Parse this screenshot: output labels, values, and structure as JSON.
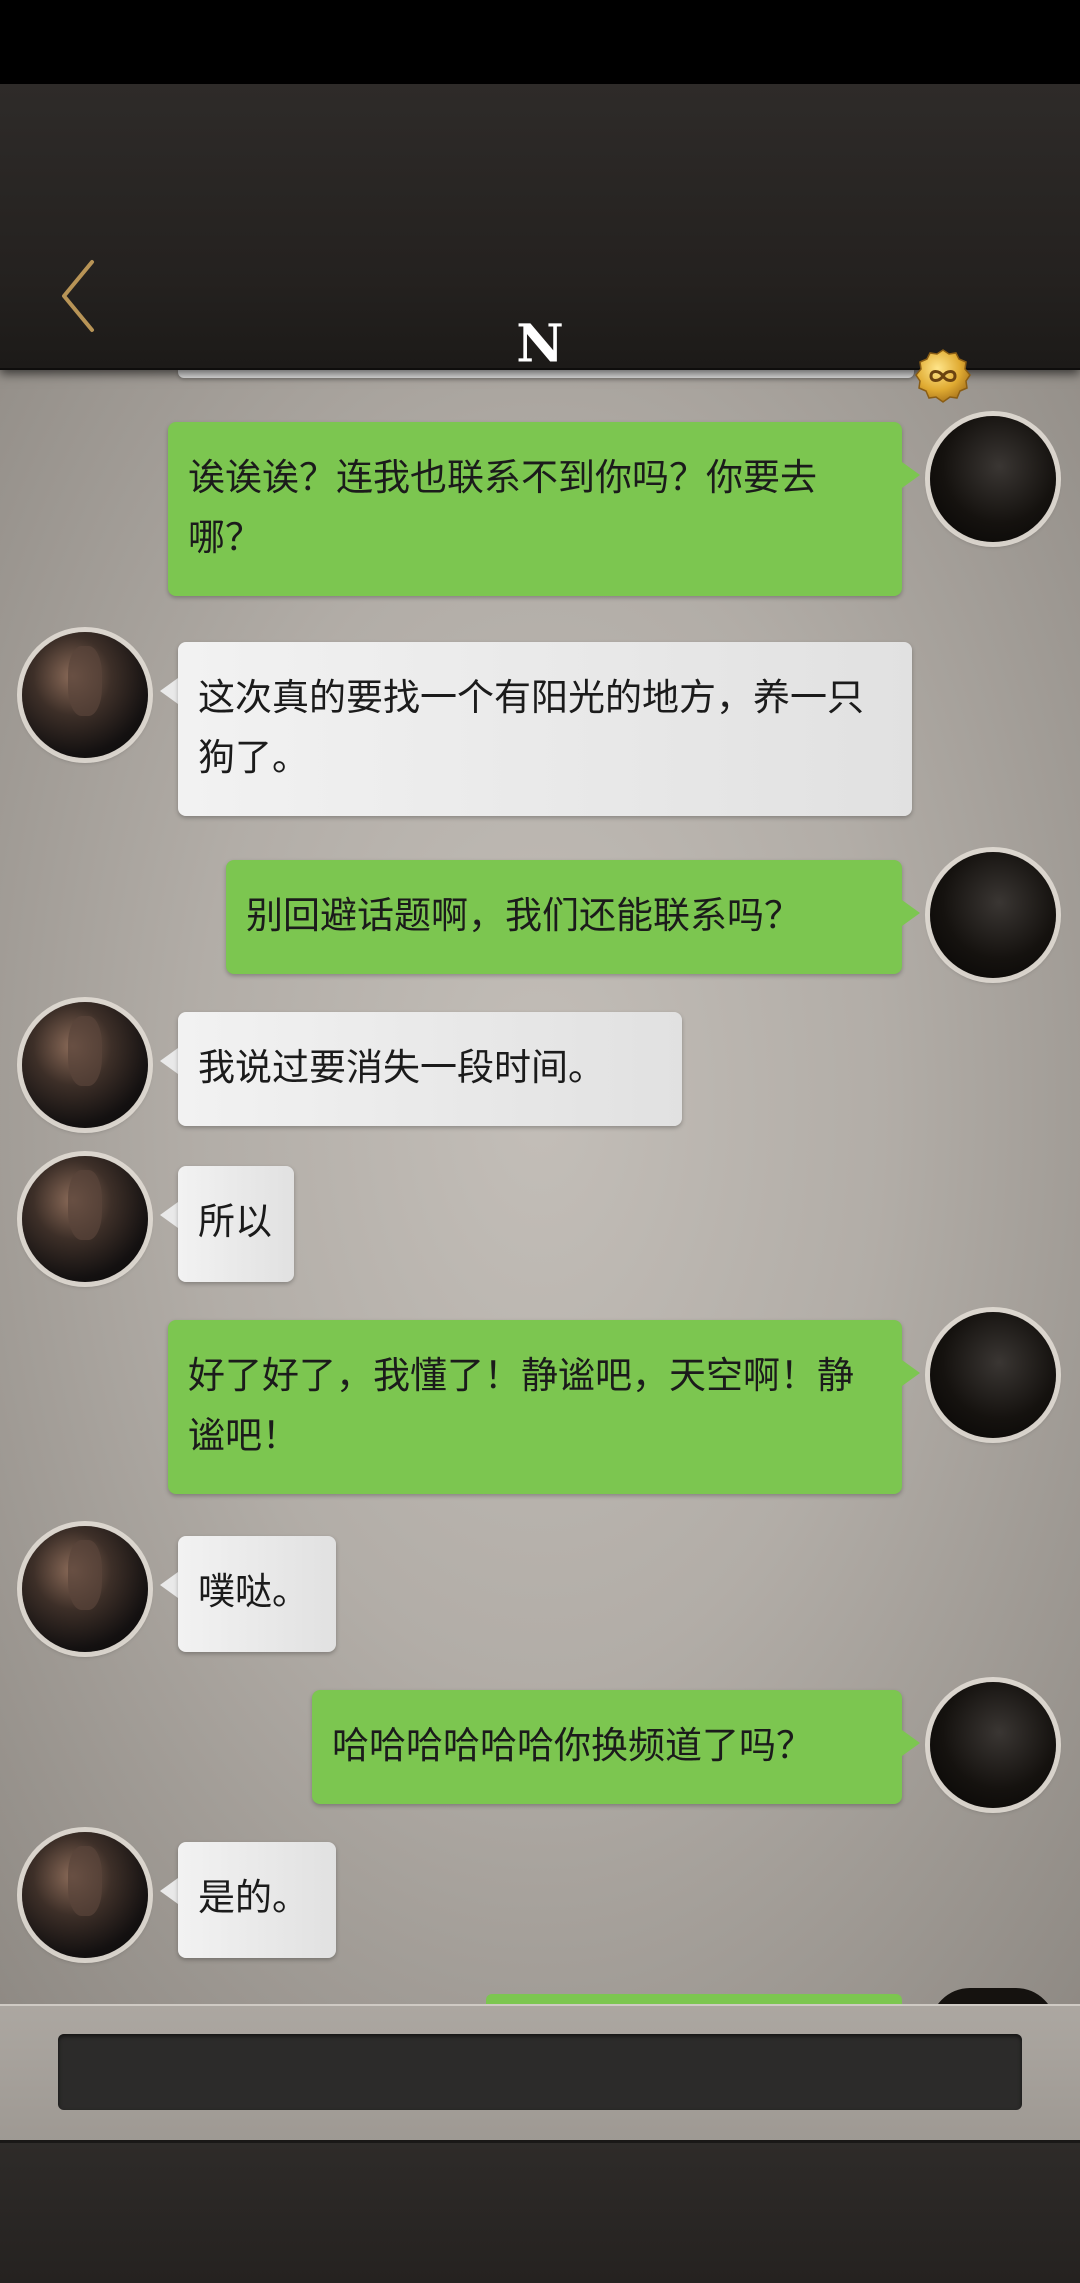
{
  "header": {
    "title": "N",
    "back_icon": "chevron-left-icon",
    "coin_icon": "infinity-coin-icon"
  },
  "colors": {
    "header_bg": "#2a2725",
    "my_bubble": "#7cc650",
    "their_bubble": "#e9e9e9",
    "chat_bg": "#b2ada7",
    "accent_gold": "#d9a93a"
  },
  "messages": [
    {
      "sender": "me",
      "text": "诶诶诶？连我也联系不到你吗？你要去哪？"
    },
    {
      "sender": "them",
      "text": "这次真的要找一个有阳光的地方，养一只狗了。"
    },
    {
      "sender": "me",
      "text": "别回避话题啊，我们还能联系吗？"
    },
    {
      "sender": "them",
      "text": "我说过要消失一段时间。"
    },
    {
      "sender": "them",
      "text": "所以"
    },
    {
      "sender": "me",
      "text": "好了好了，我懂了！静谧吧，天空啊！静谧吧！"
    },
    {
      "sender": "them",
      "text": "噗哒。"
    },
    {
      "sender": "me",
      "text": "哈哈哈哈哈哈你换频道了吗？"
    },
    {
      "sender": "them",
      "text": "是的。"
    }
  ],
  "input": {
    "placeholder": "",
    "value": ""
  }
}
